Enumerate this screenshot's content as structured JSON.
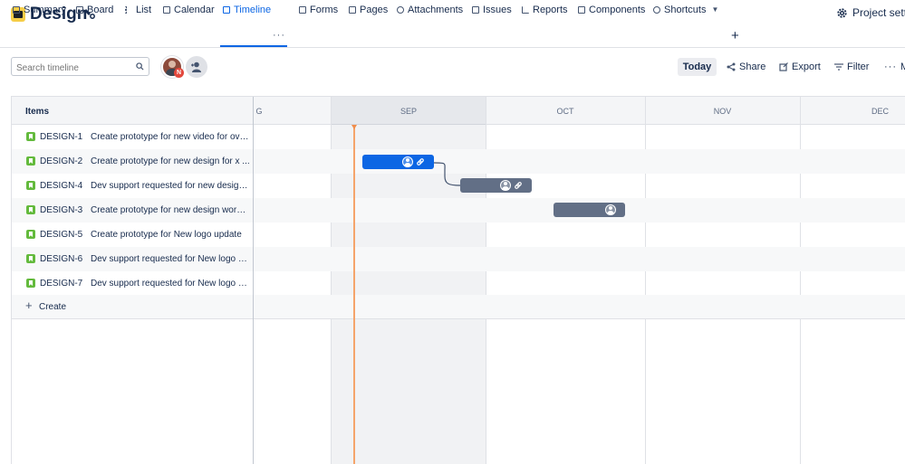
{
  "header": {
    "project_title": "Design",
    "settings_label": "Project settin"
  },
  "tabs": [
    {
      "label": "Summary",
      "icon": "summary-icon"
    },
    {
      "label": "Board",
      "icon": "board-icon"
    },
    {
      "label": "List",
      "icon": "list-icon"
    },
    {
      "label": "Calendar",
      "icon": "calendar-icon"
    },
    {
      "label": "Timeline",
      "icon": "timeline-icon",
      "active": true
    },
    {
      "label": "Forms",
      "icon": "forms-icon"
    },
    {
      "label": "Pages",
      "icon": "pages-icon"
    },
    {
      "label": "Attachments",
      "icon": "attachment-icon"
    },
    {
      "label": "Issues",
      "icon": "issues-icon"
    },
    {
      "label": "Reports",
      "icon": "reports-icon"
    },
    {
      "label": "Components",
      "icon": "components-icon"
    },
    {
      "label": "Shortcuts",
      "icon": "link-icon"
    }
  ],
  "toolbar": {
    "search_placeholder": "Search timeline",
    "avatar_badge": "N",
    "today_label": "Today",
    "share_label": "Share",
    "export_label": "Export",
    "filter_label": "Filter",
    "more_label": "Mo"
  },
  "timeline": {
    "items_header": "Items",
    "months": [
      "G",
      "SEP",
      "OCT",
      "NOV",
      "DEC"
    ],
    "create_label": "Create",
    "rows": [
      {
        "key": "DESIGN-1",
        "summary": "Create prototype for new video for ove..."
      },
      {
        "key": "DESIGN-2",
        "summary": "Create prototype for new design for x ..."
      },
      {
        "key": "DESIGN-4",
        "summary": "Dev support requested for new design..."
      },
      {
        "key": "DESIGN-3",
        "summary": "Create prototype for new design work ..."
      },
      {
        "key": "DESIGN-5",
        "summary": "Create prototype for New logo update"
      },
      {
        "key": "DESIGN-6",
        "summary": "Dev support requested for New logo u..."
      },
      {
        "key": "DESIGN-7",
        "summary": "Dev support requested for New logo u..."
      }
    ]
  },
  "colors": {
    "accent": "#0c66e4",
    "bar_grey": "#626f86",
    "today_line": "#f5a46b",
    "story_green": "#63ba3c"
  }
}
